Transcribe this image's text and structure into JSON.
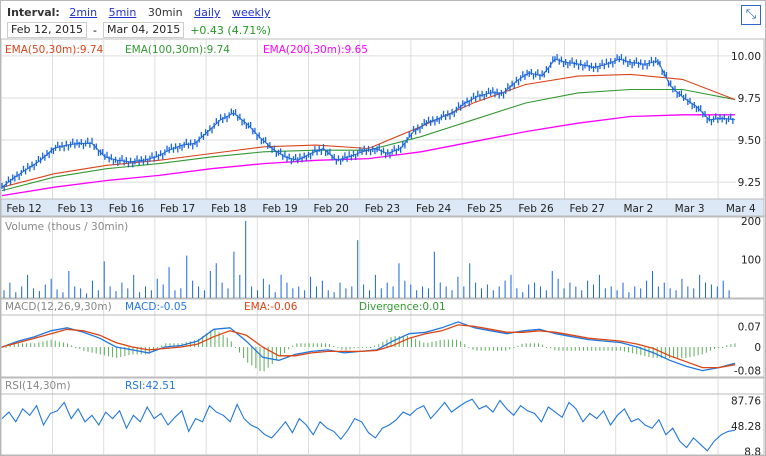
{
  "header": {
    "interval_label": "Interval:",
    "intervals": [
      "2min",
      "5min",
      "30min",
      "daily",
      "weekly"
    ],
    "selected": "30min",
    "start_date": "Feb 12, 2015",
    "separator": "-",
    "end_date": "Mar 04, 2015",
    "change": "+0.43 (4.71%)"
  },
  "colors": {
    "price": "#1a66d9",
    "ema50": "#d9441a",
    "ema100": "#339933",
    "ema200": "#ff00ff",
    "macd": "#2277dd",
    "signal": "#dd4411",
    "div": "#339933",
    "rsi": "#2277dd"
  },
  "chart_data": [
    {
      "type": "line",
      "title": "Price",
      "legend": [
        "EMA(50,30m):9.74",
        "EMA(100,30m):9.74",
        "EMA(200,30m):9.65"
      ],
      "categories": [
        "Feb 12",
        "Feb 13",
        "Feb 16",
        "Feb 17",
        "Feb 18",
        "Feb 19",
        "Feb 20",
        "Feb 23",
        "Feb 24",
        "Feb 25",
        "Feb 26",
        "Feb 27",
        "Mar 2",
        "Mar 3",
        "Mar 4"
      ],
      "yticks": [
        "10.00",
        "9.75",
        "9.50",
        "9.25"
      ],
      "ylim": [
        9.15,
        10.1
      ],
      "price": [
        9.22,
        9.28,
        9.33,
        9.38,
        9.45,
        9.47,
        9.48,
        9.48,
        9.4,
        9.38,
        9.37,
        9.38,
        9.4,
        9.44,
        9.47,
        9.48,
        9.55,
        9.62,
        9.66,
        9.6,
        9.52,
        9.45,
        9.4,
        9.38,
        9.42,
        9.45,
        9.38,
        9.4,
        9.43,
        9.45,
        9.42,
        9.45,
        9.55,
        9.6,
        9.63,
        9.66,
        9.72,
        9.76,
        9.78,
        9.78,
        9.85,
        9.9,
        9.88,
        9.98,
        9.96,
        9.95,
        9.93,
        9.95,
        9.98,
        9.96,
        9.95,
        9.97,
        9.82,
        9.75,
        9.7,
        9.62,
        9.63,
        9.62
      ],
      "ema50": [
        9.22,
        9.3,
        9.35,
        9.38,
        9.42,
        9.46,
        9.47,
        9.45,
        9.58,
        9.72,
        9.83,
        9.88,
        9.89,
        9.86,
        9.74
      ],
      "ema100": [
        9.2,
        9.28,
        9.33,
        9.36,
        9.4,
        9.43,
        9.44,
        9.44,
        9.52,
        9.62,
        9.72,
        9.78,
        9.8,
        9.8,
        9.74
      ],
      "ema200": [
        9.17,
        9.22,
        9.26,
        9.29,
        9.33,
        9.36,
        9.38,
        9.39,
        9.43,
        9.49,
        9.55,
        9.6,
        9.64,
        9.65,
        9.65
      ]
    },
    {
      "type": "bar",
      "title": "Volume (thous / 30min)",
      "yticks": [
        "200",
        "100"
      ],
      "ylim": [
        0,
        210
      ],
      "values": [
        20,
        40,
        15,
        30,
        60,
        25,
        18,
        35,
        50,
        22,
        15,
        70,
        30,
        25,
        12,
        45,
        20,
        95,
        30,
        18,
        40,
        25,
        60,
        15,
        30,
        20,
        50,
        35,
        80,
        20,
        25,
        110,
        45,
        30,
        20,
        70,
        90,
        40,
        25,
        120,
        60,
        200,
        30,
        20,
        50,
        35,
        15,
        60,
        40,
        25,
        30,
        20,
        55,
        30,
        45,
        20,
        15,
        40,
        25,
        30,
        150,
        35,
        20,
        60,
        25,
        40,
        30,
        90,
        45,
        35,
        20,
        30,
        25,
        120,
        40,
        30,
        20,
        55,
        30,
        90,
        40,
        25,
        35,
        20,
        30,
        45,
        60,
        25,
        15,
        35,
        40,
        30,
        20,
        70,
        50,
        25,
        40,
        30,
        20,
        45,
        35,
        60,
        25,
        30,
        20,
        40,
        15,
        30,
        25,
        45,
        70,
        30,
        40,
        25,
        20,
        50,
        30,
        25,
        60,
        40,
        35,
        30,
        45,
        20
      ]
    },
    {
      "type": "line",
      "title": "MACD(12,26,9,30m)",
      "legend": [
        "MACD:-0.05",
        "EMA:-0.06",
        "Divergence:0.01"
      ],
      "yticks": [
        "0.07",
        "0",
        "-0.08"
      ],
      "ylim": [
        -0.095,
        0.095
      ],
      "macd": [
        0.0,
        0.02,
        0.035,
        0.055,
        0.065,
        0.05,
        0.03,
        0.0,
        -0.01,
        -0.02,
        0.0,
        0.005,
        0.02,
        0.06,
        0.065,
        0.02,
        -0.035,
        -0.045,
        -0.025,
        -0.015,
        -0.01,
        -0.02,
        -0.015,
        -0.01,
        0.02,
        0.045,
        0.05,
        0.065,
        0.085,
        0.065,
        0.055,
        0.045,
        0.055,
        0.06,
        0.045,
        0.035,
        0.025,
        0.02,
        0.015,
        0.0,
        -0.02,
        -0.045,
        -0.065,
        -0.08,
        -0.07,
        -0.055
      ],
      "signal": [
        0.0,
        0.015,
        0.03,
        0.045,
        0.06,
        0.055,
        0.04,
        0.015,
        0.0,
        -0.01,
        -0.005,
        0.0,
        0.01,
        0.035,
        0.055,
        0.04,
        0.0,
        -0.03,
        -0.03,
        -0.02,
        -0.015,
        -0.015,
        -0.015,
        -0.012,
        0.005,
        0.03,
        0.045,
        0.055,
        0.075,
        0.07,
        0.06,
        0.05,
        0.05,
        0.055,
        0.05,
        0.04,
        0.03,
        0.025,
        0.02,
        0.01,
        -0.005,
        -0.03,
        -0.05,
        -0.07,
        -0.07,
        -0.06
      ]
    },
    {
      "type": "line",
      "title": "RSI(14,30m)",
      "legend": [
        "RSI:42.51"
      ],
      "yticks": [
        "87.76",
        "48.28",
        "8.8"
      ],
      "ylim": [
        5,
        95
      ],
      "values": [
        60,
        70,
        55,
        75,
        65,
        80,
        50,
        68,
        72,
        85,
        60,
        75,
        55,
        65,
        50,
        70,
        60,
        72,
        45,
        65,
        55,
        78,
        60,
        68,
        50,
        62,
        72,
        40,
        60,
        55,
        80,
        70,
        65,
        55,
        82,
        60,
        50,
        45,
        35,
        30,
        42,
        55,
        38,
        60,
        50,
        35,
        55,
        45,
        40,
        28,
        42,
        60,
        55,
        38,
        30,
        45,
        50,
        58,
        70,
        65,
        75,
        80,
        60,
        72,
        85,
        70,
        78,
        85,
        90,
        75,
        80,
        70,
        88,
        75,
        65,
        80,
        72,
        68,
        55,
        78,
        70,
        62,
        85,
        75,
        55,
        68,
        60,
        72,
        50,
        65,
        75,
        55,
        60,
        50,
        45,
        58,
        35,
        45,
        25,
        15,
        30,
        20,
        10,
        25,
        35,
        40,
        42
      ]
    }
  ]
}
